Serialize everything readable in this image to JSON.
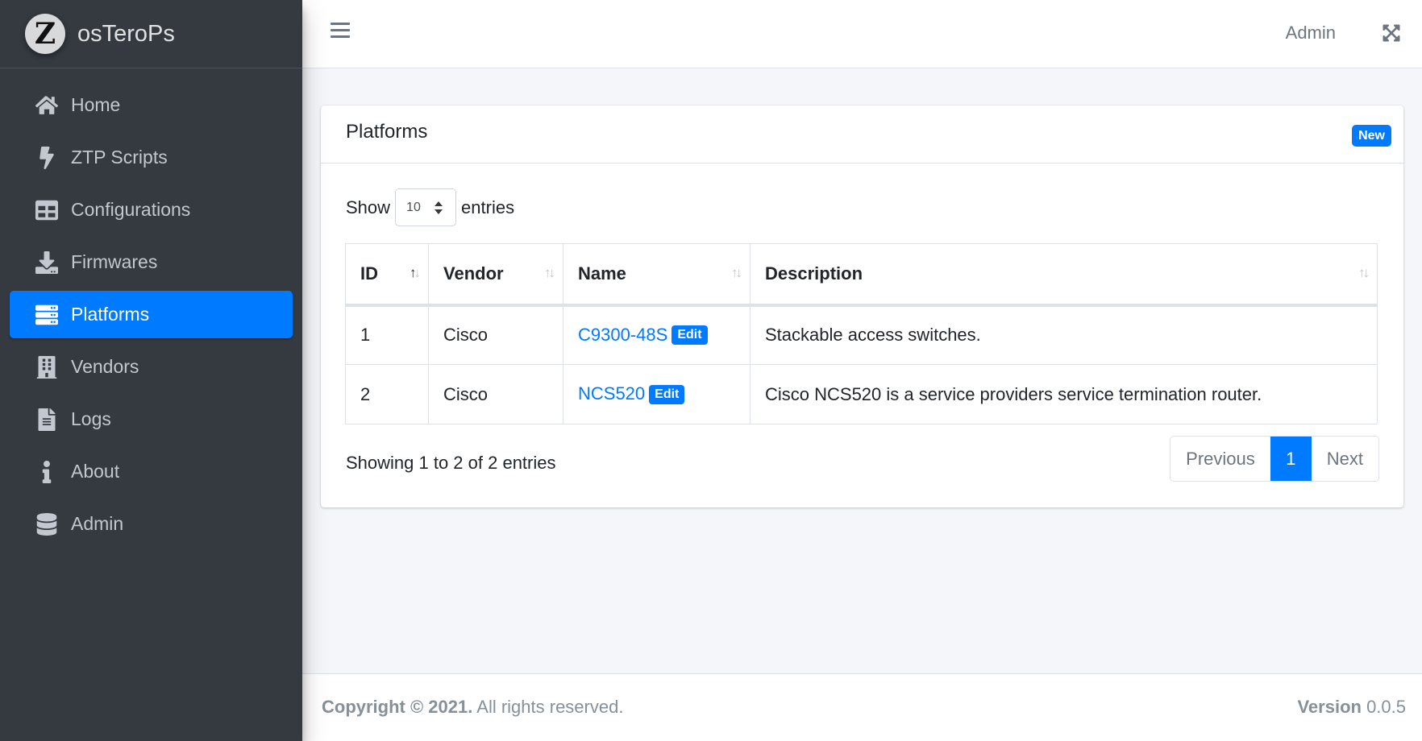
{
  "brand": {
    "logo_letter": "Z",
    "name": "osTeroPs"
  },
  "sidebar": {
    "items": [
      {
        "label": "Home",
        "icon": "home-icon",
        "active": false
      },
      {
        "label": "ZTP Scripts",
        "icon": "bolt-icon",
        "active": false
      },
      {
        "label": "Configurations",
        "icon": "table-icon",
        "active": false
      },
      {
        "label": "Firmwares",
        "icon": "download-icon",
        "active": false
      },
      {
        "label": "Platforms",
        "icon": "server-icon",
        "active": true
      },
      {
        "label": "Vendors",
        "icon": "building-icon",
        "active": false
      },
      {
        "label": "Logs",
        "icon": "file-icon",
        "active": false
      },
      {
        "label": "About",
        "icon": "info-icon",
        "active": false
      },
      {
        "label": "Admin",
        "icon": "database-icon",
        "active": false
      }
    ],
    "active_color": "#007bff"
  },
  "topbar": {
    "menu_icon": "hamburger-icon",
    "user_label": "Admin",
    "fullscreen_icon": "expand-icon"
  },
  "card": {
    "title": "Platforms",
    "new_label": "New",
    "show_label": "Show",
    "entries_label": "entries",
    "page_length": "10",
    "columns": [
      "ID",
      "Vendor",
      "Name",
      "Description"
    ],
    "rows": [
      {
        "id": "1",
        "vendor": "Cisco",
        "name": "C9300-48S",
        "edit": "Edit",
        "description": "Stackable access switches."
      },
      {
        "id": "2",
        "vendor": "Cisco",
        "name": "NCS520",
        "edit": "Edit",
        "description": "Cisco NCS520 is a service providers service termination router."
      }
    ],
    "info": "Showing 1 to 2 of 2 entries",
    "pagination": {
      "previous": "Previous",
      "current": "1",
      "next": "Next"
    }
  },
  "footer": {
    "copyright_bold": "Copyright © 2021.",
    "copyright_rest": " All rights reserved.",
    "version_label": "Version",
    "version": " 0.0.5"
  }
}
